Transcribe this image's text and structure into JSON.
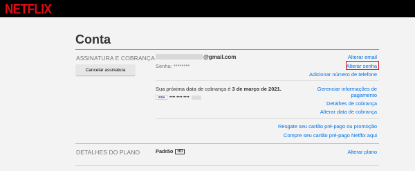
{
  "brand": {
    "logo_text": "NETFLIX",
    "logo_color": "#e50914",
    "link_color": "#0073e6"
  },
  "page": {
    "title": "Conta"
  },
  "membership": {
    "section_label": "ASSINATURA E COBRANÇA",
    "cancel_button": "Cancelar assinatura",
    "email_domain": "@gmail.com",
    "password": "Senha: ********",
    "links": {
      "change_email": "Alterar email",
      "change_password": "Alterar senha",
      "add_phone": "Adicionar número de telefone"
    }
  },
  "billing": {
    "next_billing_prefix": "Sua próxima data de cobrança é ",
    "next_billing_date": "3 de março de 2021.",
    "card_brand": "VISA",
    "card_masked": "•••• •••• ••••",
    "links": {
      "manage_payment_line1": "Gerenciar informações de",
      "manage_payment_line2": "pagamento",
      "billing_details": "Detalhes de cobrança",
      "change_billing_date": "Alterar data de cobrança"
    }
  },
  "gift": {
    "redeem": "Resgate seu cartão pré-pago ou promoção",
    "buy": "Compre seu cartão pré-pago Netflix aqui"
  },
  "plan": {
    "section_label": "DETALHES DO PLANO",
    "name": "Padrão",
    "badge": "HD",
    "change_plan": "Alterar plano"
  }
}
